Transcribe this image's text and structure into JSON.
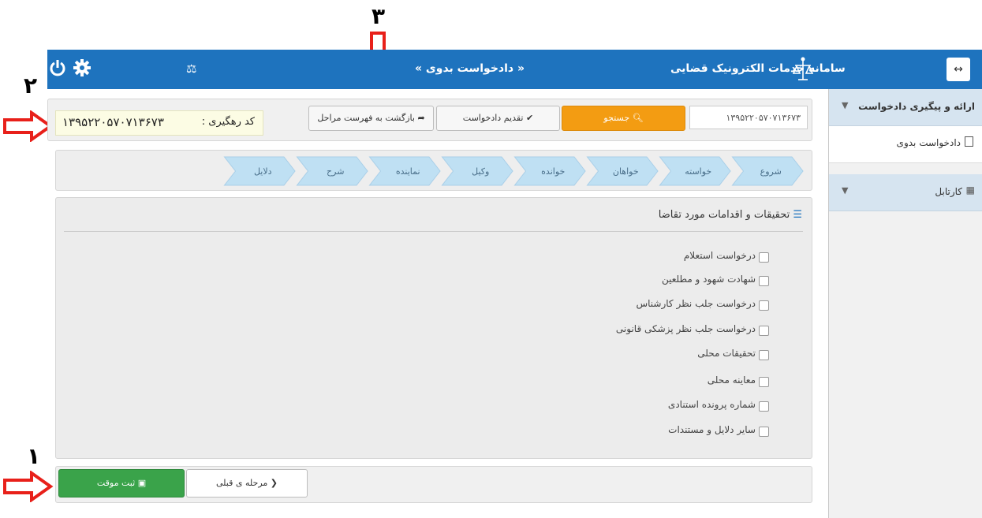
{
  "annotations": {
    "n1": "۱",
    "n2": "۲",
    "n3": "۳"
  },
  "header": {
    "title": "سامانه خدمات الکترونیک قضایی",
    "breadcrumb": "« دادخواست بدوی »",
    "menu_toggle": "↔"
  },
  "tracking": {
    "label": "کد رهگیری :",
    "code": "۱۳۹۵۲۲۰۵۷۰۷۱۳۶۷۳"
  },
  "toolbar": {
    "back_label": "بازگشت به فهرست مراحل",
    "submit_label": "تقدیم دادخواست",
    "search_label": "جستجو",
    "search_value": "۱۳۹۵۲۲۰۵۷۰۷۱۳۶۷۳"
  },
  "steps": [
    "شروع",
    "خواسته",
    "خواهان",
    "خوانده",
    "وکیل",
    "نماینده",
    "شرح",
    "دلایل"
  ],
  "section": {
    "title": "تحقیقات و اقدامات مورد تقاضا",
    "options": [
      "درخواست استعلام",
      "شهادت شهود و مطلعین",
      "درخواست جلب نظر کارشناس",
      "درخواست جلب نظر پزشکی قانونی",
      "تحقیقات محلی",
      "معاینه محلی",
      "شماره پرونده استنادی",
      "سایر دلایل و مستندات"
    ]
  },
  "footer": {
    "prev_label": "مرحله ی قبلی",
    "save_label": "ثبت موقت"
  },
  "sidebar": {
    "items": [
      {
        "label": "ارائه و پیگیری دادخواست"
      },
      {
        "label": "دادخواست بدوی"
      },
      {
        "label": "کارتابل"
      }
    ]
  },
  "colors": {
    "header": "#1e73be",
    "search": "#f39c12",
    "save": "#3aa34a",
    "step": "#bfe0f3",
    "annotation_arrow": "#e8201a"
  },
  "icons": [
    "power-icon",
    "gear-icon",
    "scales-icon",
    "search-icon",
    "check-icon",
    "reply-icon",
    "save-icon",
    "chevron-left-icon",
    "list-icon",
    "grid-icon"
  ]
}
